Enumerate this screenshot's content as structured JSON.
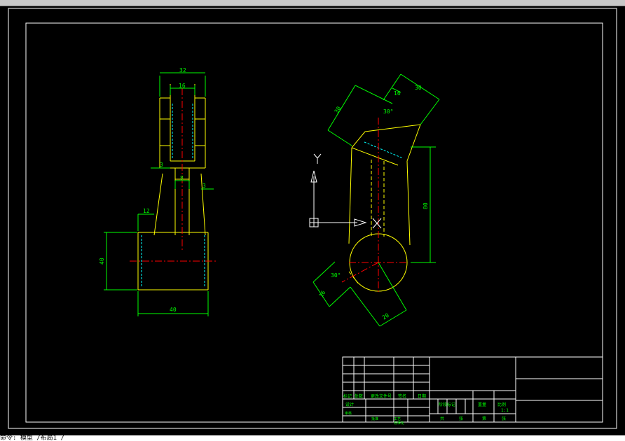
{
  "colors": {
    "background": "#000000",
    "frame": "#ffffff",
    "geometry": "#ffff00",
    "dimension": "#00ff00",
    "centerline": "#ff0000",
    "hidden": "#00ffff",
    "ucs": "#ffffff"
  },
  "front_view": {
    "dims": {
      "top_outer": "32",
      "top_inner": "16",
      "left_small": "3",
      "neck": "8",
      "right_small": "3",
      "base_offset": "12",
      "base_height": "40",
      "base_width": "40"
    }
  },
  "side_view": {
    "dims": {
      "slant_left": "30",
      "slant_top_a": "16",
      "slant_top_b": "30",
      "angle_top": "30°",
      "vertical_height": "80",
      "angle_bottom": "30°",
      "bottom_short": "16",
      "bottom_long": "20"
    },
    "ucs": {
      "y_label": "Y",
      "x_label": "X"
    }
  },
  "title_block": {
    "labels": {
      "mark": "标记",
      "count": "处数",
      "doc_no": "更改文件号",
      "sign": "签名",
      "date": "日期",
      "design": "设计",
      "standard": "标准化",
      "stage_mark": "阶段标记",
      "weight": "重量",
      "scale": "比例",
      "scale_value": "1:1",
      "review": "审核",
      "process": "工艺",
      "approve": "批准",
      "total": "共",
      "sheet": "张",
      "page": "第",
      "sheet2": "张"
    }
  },
  "command_line": {
    "text": "命令: 模型 /布局1 /"
  }
}
